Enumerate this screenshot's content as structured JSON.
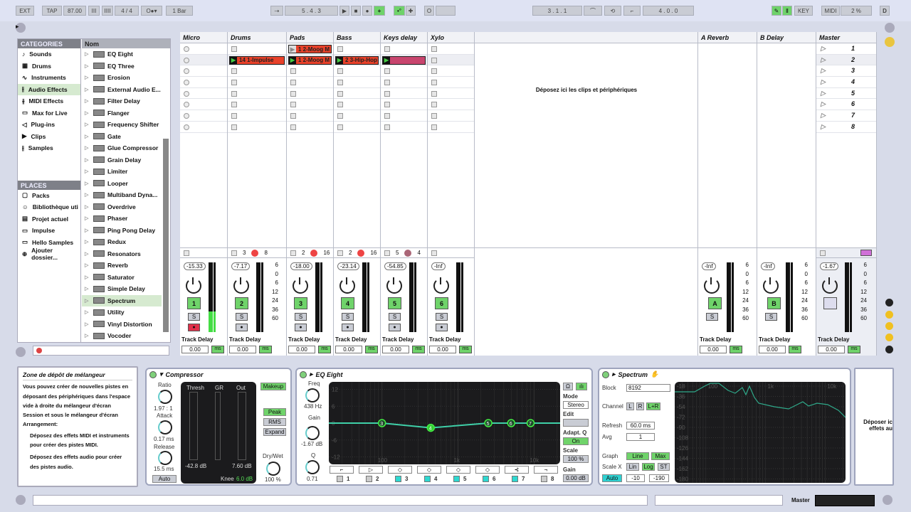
{
  "transport": {
    "ext": "EXT",
    "tap": "TAP",
    "tempo": "87.00",
    "signature": "4 / 4",
    "quantize": "1 Bar",
    "position": "5 . 4 . 3",
    "loop_start": "3 . 1 . 1",
    "loop_length": "4 . 0 . 0",
    "key": "KEY",
    "midi": "MIDI",
    "cpu": "2 %",
    "d": "D"
  },
  "browser": {
    "categories_header": "CATEGORIES",
    "categories": [
      {
        "label": "Sounds",
        "icon": "♪"
      },
      {
        "label": "Drums",
        "icon": "▦"
      },
      {
        "label": "Instruments",
        "icon": "∿"
      },
      {
        "label": "Audio Effects",
        "icon": "⫲",
        "selected": true
      },
      {
        "label": "MIDI Effects",
        "icon": "⫳"
      },
      {
        "label": "Max for Live",
        "icon": "▭"
      },
      {
        "label": "Plug-ins",
        "icon": "◁"
      },
      {
        "label": "Clips",
        "icon": "▶"
      },
      {
        "label": "Samples",
        "icon": "⫲"
      }
    ],
    "places_header": "PLACES",
    "places": [
      {
        "label": "Packs",
        "icon": "▢"
      },
      {
        "label": "Bibliothèque uti",
        "icon": "☺"
      },
      {
        "label": "Projet actuel",
        "icon": "▤"
      },
      {
        "label": "Impulse",
        "icon": "▭"
      },
      {
        "label": "Hello Samples",
        "icon": "▭"
      },
      {
        "label": "Ajouter dossier...",
        "icon": "⊕"
      }
    ],
    "list_header": "Nom",
    "items": [
      "EQ Eight",
      "EQ Three",
      "Erosion",
      "External Audio E...",
      "Filter Delay",
      "Flanger",
      "Frequency Shifter",
      "Gate",
      "Glue Compressor",
      "Grain Delay",
      "Limiter",
      "Looper",
      "Multiband Dyna...",
      "Overdrive",
      "Phaser",
      "Ping Pong Delay",
      "Redux",
      "Resonators",
      "Reverb",
      "Saturator",
      "Simple Delay",
      "Spectrum",
      "Utility",
      "Vinyl Distortion",
      "Vocoder"
    ],
    "selected_item": "Spectrum"
  },
  "session": {
    "drop_text": "Déposez ici les clips et périphériques",
    "track_delay_label": "Track Delay",
    "unit": "ms",
    "tracks": [
      {
        "name": "Micro",
        "slot": "circle",
        "io": [
          "",
          "",
          ""
        ],
        "volume": "-15.33",
        "number": "1",
        "delay": "0.00",
        "armed": true
      },
      {
        "name": "Drums",
        "slot": "square",
        "io": [
          "3",
          "●",
          "8"
        ],
        "volume": "-7.17",
        "number": "2",
        "delay": "0.00",
        "clips": {
          "1": {
            "label": "14 1-Impulse",
            "color": "#e8412a",
            "playing": true
          }
        }
      },
      {
        "name": "Pads",
        "slot": "square",
        "io": [
          "2",
          "●",
          "16"
        ],
        "volume": "-18.00",
        "number": "3",
        "delay": "0.00",
        "clips": {
          "0": {
            "label": "1 2-Moog M",
            "color": "#e8412a",
            "playing": false
          },
          "1": {
            "label": "1 2-Moog M",
            "color": "#e8412a",
            "playing": true
          }
        }
      },
      {
        "name": "Bass",
        "slot": "square",
        "io": [
          "2",
          "●",
          "16"
        ],
        "volume": "-23.14",
        "number": "4",
        "delay": "0.00",
        "clips": {
          "1": {
            "label": "2 3-Hip-Hop",
            "color": "#e8412a",
            "playing": true
          }
        }
      },
      {
        "name": "Keys delay",
        "slot": "square",
        "io": [
          "5",
          "●",
          "4"
        ],
        "volume": "-54.85",
        "number": "5",
        "delay": "0.00",
        "clips": {
          "1": {
            "label": "",
            "color": "#c8456e",
            "playing": true
          }
        }
      },
      {
        "name": "Xylo",
        "slot": "square",
        "io": [
          "",
          "",
          ""
        ],
        "volume": "-Inf",
        "number": "6",
        "delay": "0.00"
      }
    ],
    "returns": [
      {
        "name": "A Reverb",
        "volume": "-Inf",
        "letter": "A",
        "delay": "0.00"
      },
      {
        "name": "B Delay",
        "volume": "-Inf",
        "letter": "B",
        "delay": "0.00"
      }
    ],
    "master": {
      "name": "Master",
      "volume": "-1.67",
      "delay": "0.00",
      "scenes": [
        "1",
        "2",
        "3",
        "4",
        "5",
        "6",
        "7",
        "8"
      ]
    },
    "meter_scale": [
      "6",
      "0",
      "6",
      "12",
      "24",
      "36",
      "60"
    ],
    "solo": "S"
  },
  "info": {
    "title": "Zone de dépôt de mélangeur",
    "p1": "Vous pouvez créer de nouvelles pistes en déposant des périphériques dans l'espace vide à droite du mélangeur d'écran Session et sous le mélangeur d'écran Arrangement:",
    "b1": "Déposez des effets MIDI et instruments pour créer des pistes MIDI.",
    "b2": "Déposez des effets audio pour créer des pistes audio."
  },
  "compressor": {
    "title": "Compressor",
    "ratio_label": "Ratio",
    "ratio": "1.97 : 1",
    "attack_label": "Attack",
    "attack": "0.17 ms",
    "release_label": "Release",
    "release": "15.5 ms",
    "auto": "Auto",
    "thresh": "Thresh",
    "gr": "GR",
    "out": "Out",
    "thresh_val": "-42.8 dB",
    "out_val": "7.60 dB",
    "knee_label": "Knee",
    "knee": "6.0 dB",
    "makeup": "Makeup",
    "peak": "Peak",
    "rms": "RMS",
    "expand": "Expand",
    "drywet_label": "Dry/Wet",
    "drywet": "100 %"
  },
  "eq": {
    "title": "EQ Eight",
    "freq_label": "Freq",
    "freq": "438 Hz",
    "gain_label": "Gain",
    "gain": "-1.67 dB",
    "q_label": "Q",
    "q": "0.71",
    "y_ticks": [
      "12",
      "6",
      "0",
      "-6",
      "-12"
    ],
    "x_ticks": [
      "100",
      "1k",
      "10k"
    ],
    "mode_label": "Mode",
    "mode": "Stereo",
    "edit_label": "Edit",
    "adaptq_label": "Adapt. Q",
    "adaptq": "On",
    "scale_label": "Scale",
    "scale": "100 %",
    "outgain_label": "Gain",
    "outgain": "0.00 dB",
    "bands": [
      {
        "n": "1",
        "on": false,
        "shape": "⌐"
      },
      {
        "n": "2",
        "on": false,
        "shape": "▷"
      },
      {
        "n": "3",
        "on": true,
        "shape": "◇"
      },
      {
        "n": "4",
        "on": true,
        "shape": "◇"
      },
      {
        "n": "5",
        "on": true,
        "shape": "◇"
      },
      {
        "n": "6",
        "on": true,
        "shape": "◇"
      },
      {
        "n": "7",
        "on": true,
        "shape": "⊰"
      },
      {
        "n": "8",
        "on": false,
        "shape": "¬"
      }
    ],
    "curve_points": [
      {
        "band": "3",
        "freq_hz": 100,
        "gain_db": 0
      },
      {
        "band": "4",
        "freq_hz": 438,
        "gain_db": -1.67
      },
      {
        "band": "5",
        "freq_hz": 2500,
        "gain_db": 0
      },
      {
        "band": "6",
        "freq_hz": 5000,
        "gain_db": 0
      },
      {
        "band": "7",
        "freq_hz": 9000,
        "gain_db": 0
      }
    ]
  },
  "spectrum": {
    "title": "Spectrum",
    "block_label": "Block",
    "block": "8192",
    "channel_label": "Channel",
    "ch_l": "L",
    "ch_r": "R",
    "ch_lr": "L+R",
    "refresh_label": "Refresh",
    "refresh": "60.0 ms",
    "avg_label": "Avg",
    "avg": "1",
    "graph_label": "Graph",
    "line": "Line",
    "max": "Max",
    "scalex_label": "Scale X",
    "lin": "Lin",
    "log": "Log",
    "st": "ST",
    "auto": "Auto",
    "range_lo": "-10",
    "range_hi": "-190",
    "y_ticks": [
      "-18",
      "-36",
      "-54",
      "-72",
      "-90",
      "-108",
      "-126",
      "-144",
      "-162",
      "-180"
    ],
    "x_ticks": [
      "100",
      "1k",
      "10k"
    ]
  },
  "drop_right": {
    "line1": "Déposer ic",
    "line2": "effets au"
  },
  "status": {
    "master_label": "Master"
  },
  "colors": {
    "accent_green": "#6fd36a",
    "clip_red": "#e8412a",
    "clip_pink": "#c8456e",
    "eq_curve": "#3fd0a8"
  }
}
